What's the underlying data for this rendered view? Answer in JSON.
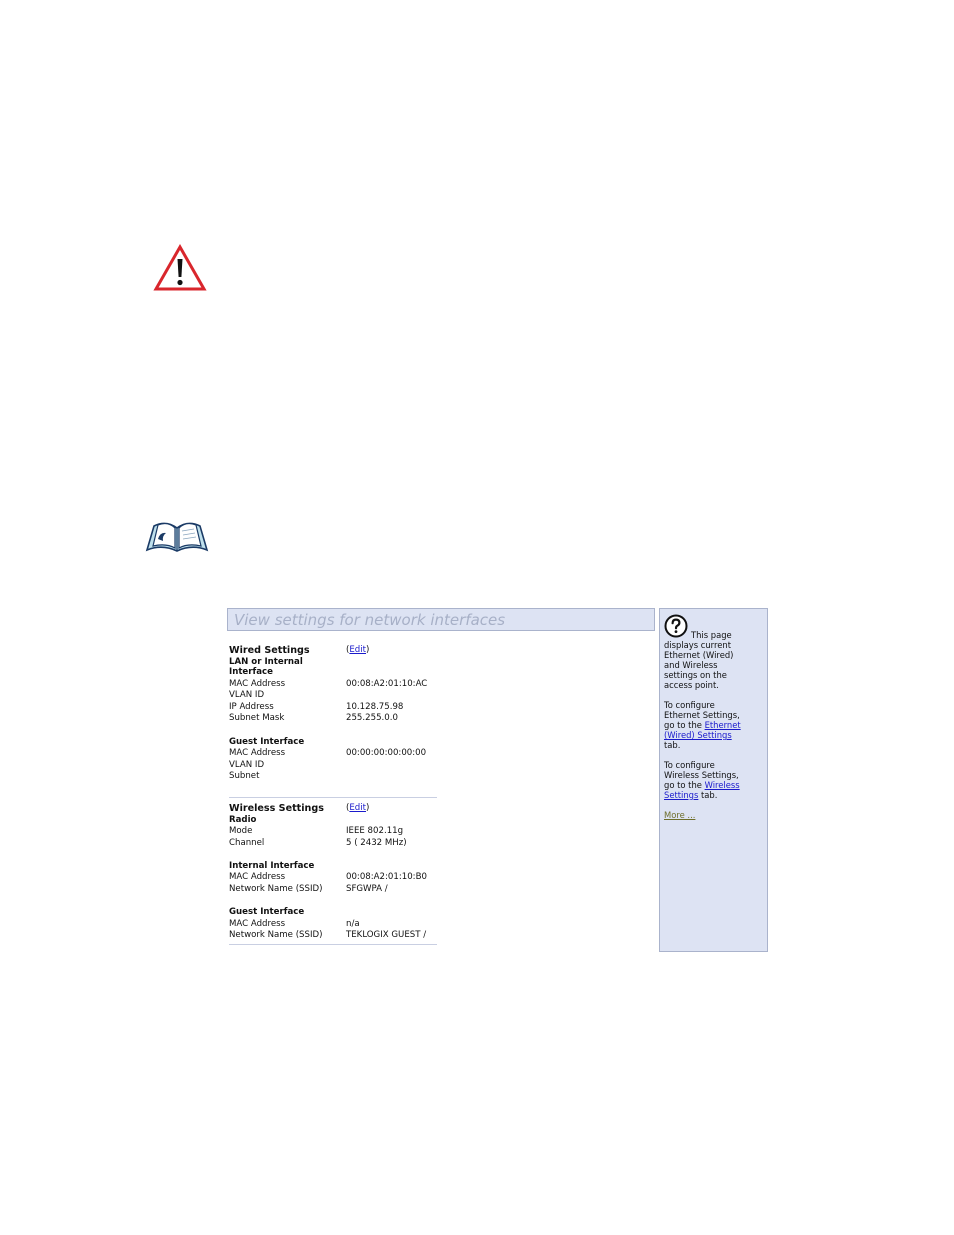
{
  "icons": {
    "caution": "caution-icon",
    "note": "note-book-icon",
    "help": "question-mark-icon"
  },
  "panel": {
    "title": "View settings for network interfaces",
    "edit_label": "Edit",
    "wired": {
      "heading": "Wired Settings",
      "subheading_line1": "LAN or Internal",
      "subheading_line2": "Interface",
      "mac_label": "MAC Address",
      "mac_value": "00:08:A2:01:10:AC",
      "vlan_label": "VLAN ID",
      "ip_label": "IP Address",
      "ip_value": "10.128.75.98",
      "mask_label": "Subnet Mask",
      "mask_value": "255.255.0.0",
      "guest_heading": "Guest Interface",
      "guest_mac_label": "MAC Address",
      "guest_mac_value": "00:00:00:00:00:00",
      "guest_vlan_label": "VLAN ID",
      "guest_subnet_label": "Subnet"
    },
    "wireless": {
      "heading": "Wireless Settings",
      "radio_heading": "Radio",
      "mode_label": "Mode",
      "mode_value": "IEEE 802.11g",
      "channel_label": "Channel",
      "channel_value": "5 ( 2432 MHz)",
      "internal_heading": "Internal Interface",
      "internal_mac_label": "MAC Address",
      "internal_mac_value": "00:08:A2:01:10:B0",
      "internal_ssid_label": "Network Name (SSID)",
      "internal_ssid_value": "SFGWPA /",
      "guest_heading": "Guest Interface",
      "guest_mac_label": "MAC Address",
      "guest_mac_value": "n/a",
      "guest_ssid_label": "Network Name (SSID)",
      "guest_ssid_value": "TEKLOGIX GUEST /"
    }
  },
  "help": {
    "intro1": "This page",
    "intro2": "displays current",
    "intro3": "Ethernet (Wired)",
    "intro4": "and Wireless",
    "intro5": "settings on the",
    "intro6": "access point.",
    "eth1": "To configure",
    "eth2": "Ethernet Settings,",
    "eth3_pre": "go to the ",
    "eth3_link": "Ethernet",
    "eth4_link": "(Wired) Settings",
    "eth5": "tab.",
    "wl1": "To configure",
    "wl2": "Wireless Settings,",
    "wl3_pre": "go to the ",
    "wl3_link": "Wireless",
    "wl4_link": "Settings",
    "wl4_post": " tab.",
    "more": "More ..."
  }
}
